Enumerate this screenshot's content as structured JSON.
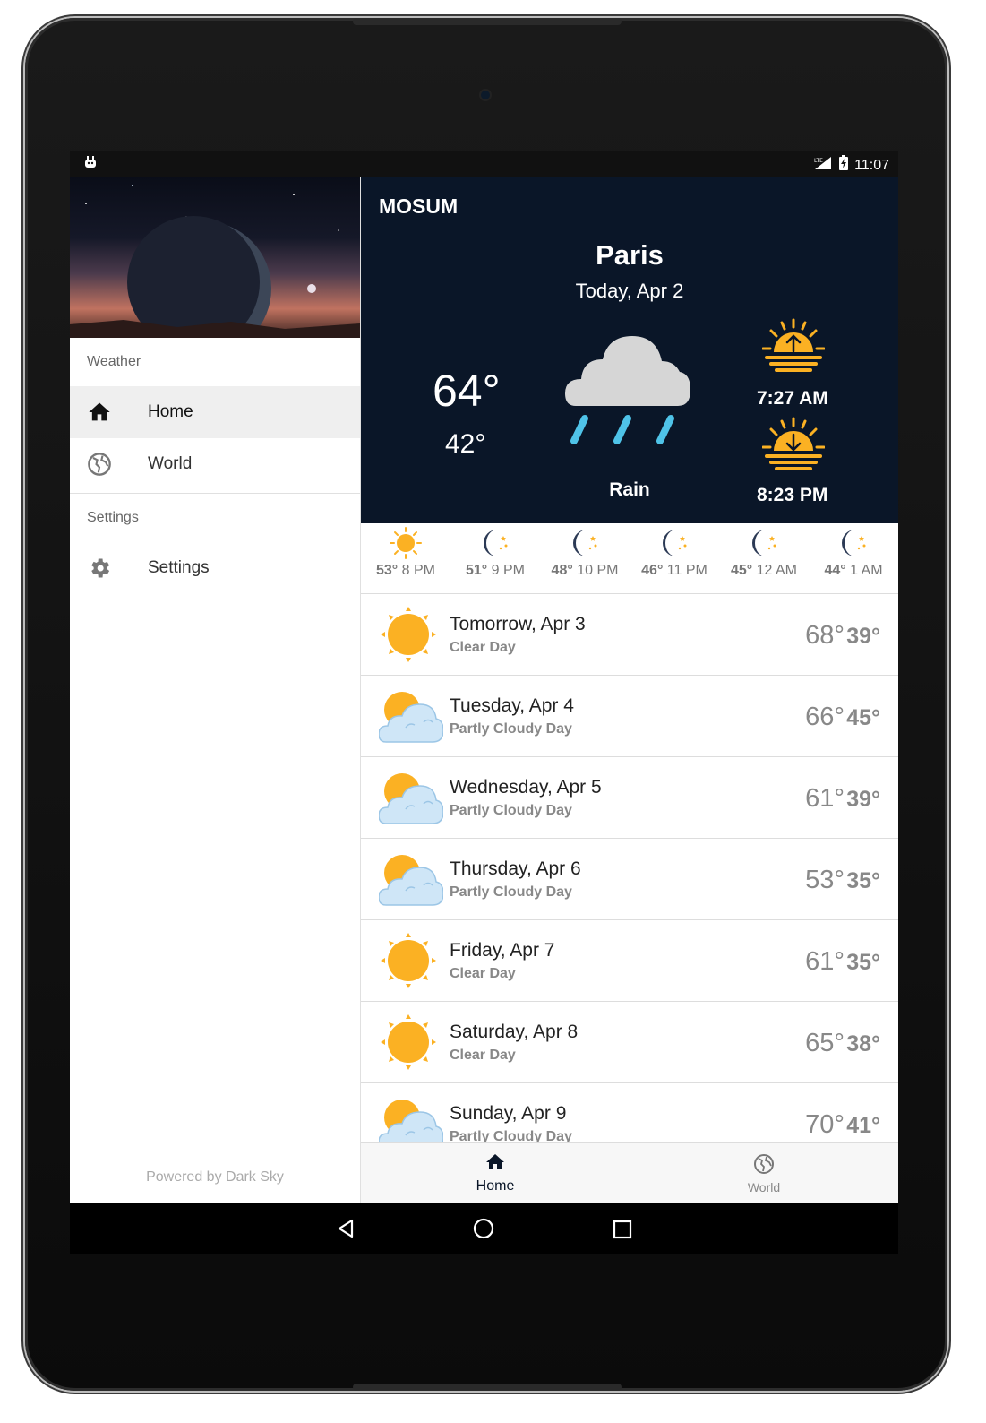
{
  "status_bar": {
    "time": "11:07",
    "network": "LTE"
  },
  "drawer": {
    "section_weather": "Weather",
    "items": [
      {
        "label": "Home",
        "icon": "home-icon",
        "active": true
      },
      {
        "label": "World",
        "icon": "globe-icon",
        "active": false
      }
    ],
    "section_settings": "Settings",
    "settings_item": {
      "label": "Settings",
      "icon": "gear-icon"
    },
    "footer": "Powered by Dark Sky"
  },
  "app": {
    "title": "MOSUM"
  },
  "current": {
    "city": "Paris",
    "date": "Today, Apr 2",
    "high": "64°",
    "low": "42°",
    "condition": "Rain",
    "condition_icon": "rain-cloud-icon",
    "sunrise": "7:27 AM",
    "sunset": "8:23 PM"
  },
  "hourly": [
    {
      "temp": "53°",
      "time": "8 PM",
      "icon": "sun-icon"
    },
    {
      "temp": "51°",
      "time": "9 PM",
      "icon": "moon-icon"
    },
    {
      "temp": "48°",
      "time": "10 PM",
      "icon": "moon-icon"
    },
    {
      "temp": "46°",
      "time": "11 PM",
      "icon": "moon-icon"
    },
    {
      "temp": "45°",
      "time": "12 AM",
      "icon": "moon-icon"
    },
    {
      "temp": "44°",
      "time": "1 AM",
      "icon": "moon-icon"
    }
  ],
  "daily": [
    {
      "day": "Tomorrow, Apr 3",
      "summary": "Clear Day",
      "high": "68°",
      "low": "39°",
      "icon": "sun-icon"
    },
    {
      "day": "Tuesday, Apr 4",
      "summary": "Partly Cloudy Day",
      "high": "66°",
      "low": "45°",
      "icon": "partly-cloudy-icon"
    },
    {
      "day": "Wednesday, Apr 5",
      "summary": "Partly Cloudy Day",
      "high": "61°",
      "low": "39°",
      "icon": "partly-cloudy-icon"
    },
    {
      "day": "Thursday, Apr 6",
      "summary": "Partly Cloudy Day",
      "high": "53°",
      "low": "35°",
      "icon": "partly-cloudy-icon"
    },
    {
      "day": "Friday, Apr 7",
      "summary": "Clear Day",
      "high": "61°",
      "low": "35°",
      "icon": "sun-icon"
    },
    {
      "day": "Saturday, Apr 8",
      "summary": "Clear Day",
      "high": "65°",
      "low": "38°",
      "icon": "sun-icon"
    },
    {
      "day": "Sunday, Apr 9",
      "summary": "Partly Cloudy Day",
      "high": "70°",
      "low": "41°",
      "icon": "partly-cloudy-icon"
    }
  ],
  "bottom_nav": [
    {
      "label": "Home",
      "icon": "home-icon",
      "active": true
    },
    {
      "label": "World",
      "icon": "globe-icon",
      "active": false
    }
  ],
  "colors": {
    "header_bg": "#0a1628",
    "sun": "#fbb123",
    "rain": "#4fc3e8",
    "cloud": "#d4d4d4"
  }
}
